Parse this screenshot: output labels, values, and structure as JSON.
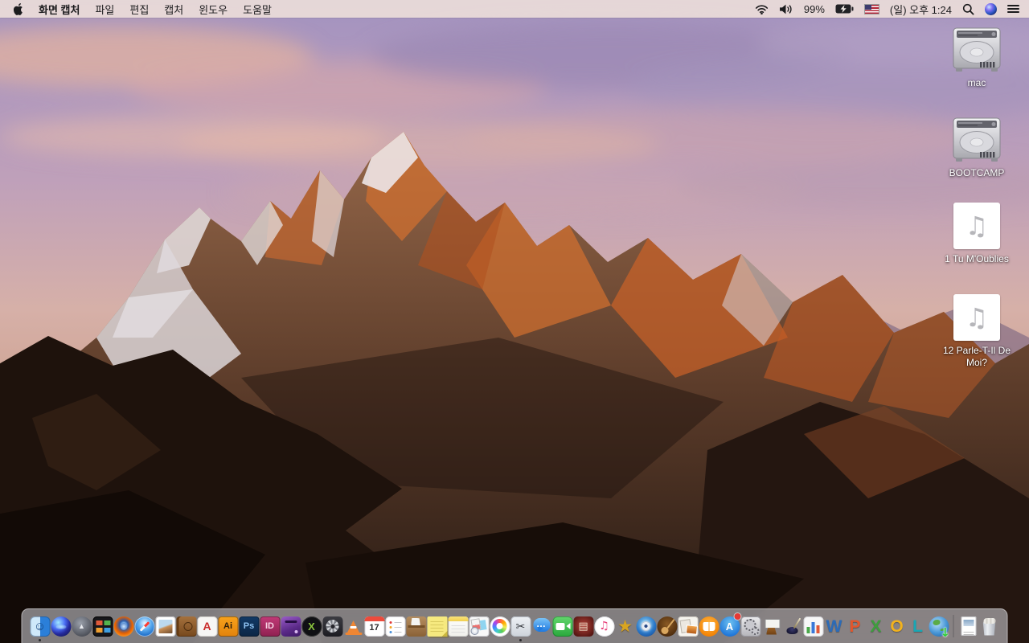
{
  "menu_bar": {
    "app_name": "화면 캡처",
    "menus": [
      "파일",
      "편집",
      "캡처",
      "윈도우",
      "도움말"
    ],
    "status": {
      "battery_percent": "99%",
      "clock": "(일) 오후 1:24"
    },
    "status_icons": [
      "wifi-icon",
      "volume-icon",
      "battery-charging-icon",
      "us-flag-keyboard-icon",
      "spotlight-search-icon",
      "siri-icon",
      "notification-center-icon"
    ]
  },
  "desktop": {
    "icons": [
      {
        "label": "mac",
        "kind": "hdd"
      },
      {
        "label": "BOOTCAMP",
        "kind": "hdd"
      },
      {
        "label": "1 Tu M'Oublies",
        "kind": "audio",
        "glyph": "♫"
      },
      {
        "label": "12 Parle-T-Il De Moi?",
        "kind": "audio",
        "glyph": "♫"
      }
    ]
  },
  "dock": {
    "items": [
      {
        "id": "finder",
        "label": "Finder",
        "kind": "finder",
        "glyph": "☺",
        "running": true
      },
      {
        "id": "siri",
        "label": "Siri",
        "kind": "siri",
        "shape": "circle"
      },
      {
        "id": "launchpad",
        "label": "Launchpad",
        "kind": "launchpad",
        "shape": "circle",
        "glyph": "▲"
      },
      {
        "id": "mission-control",
        "label": "Mission Control",
        "kind": "mission-control"
      },
      {
        "id": "firefox",
        "label": "Firefox",
        "kind": "firefox",
        "shape": "circle"
      },
      {
        "id": "safari",
        "label": "Safari",
        "kind": "safari",
        "shape": "circle"
      },
      {
        "id": "preview",
        "label": "Preview",
        "kind": "photo-bird"
      },
      {
        "id": "contacts-book",
        "label": "Leather Address Book",
        "kind": "leather-book"
      },
      {
        "id": "acrobat",
        "label": "Adobe Acrobat Reader",
        "kind": "acrobat",
        "glyph": "A",
        "fg": "#c92a2a"
      },
      {
        "id": "illustrator",
        "label": "Adobe Illustrator",
        "kind": "adobe",
        "glyph": "Ai",
        "bg": "linear-gradient(#f7a21b,#e2830d)",
        "fg": "#30200a"
      },
      {
        "id": "photoshop",
        "label": "Adobe Photoshop",
        "kind": "adobe",
        "glyph": "Ps",
        "bg": "linear-gradient(#123a66,#0b2544)",
        "fg": "#8fc3f2"
      },
      {
        "id": "indesign",
        "label": "Adobe InDesign",
        "kind": "adobe",
        "glyph": "ID",
        "bg": "linear-gradient(#c23a77,#8e2050)",
        "fg": "#f7d2e4"
      },
      {
        "id": "toast",
        "label": "Toast Titanium",
        "kind": "toast"
      },
      {
        "id": "x-media-app",
        "label": "XBMC Media App",
        "kind": "x-circle",
        "shape": "circle",
        "glyph": "X",
        "bg": "#101014",
        "fg": "#8cc63e"
      },
      {
        "id": "disk-fan-app",
        "label": "Disk Fan App",
        "kind": "fan"
      },
      {
        "id": "vlc",
        "label": "VLC",
        "kind": "vlc"
      },
      {
        "id": "calendar",
        "label": "Calendar",
        "kind": "calendar",
        "glyph": "17"
      },
      {
        "id": "reminders",
        "label": "Reminders",
        "kind": "reminders"
      },
      {
        "id": "package-box-app",
        "label": "Package Box App",
        "kind": "box"
      },
      {
        "id": "stickies",
        "label": "Stickies",
        "kind": "stickies"
      },
      {
        "id": "notes",
        "label": "Notes",
        "kind": "notes"
      },
      {
        "id": "photo-cards-app",
        "label": "Photo Cards App",
        "kind": "cards"
      },
      {
        "id": "photos",
        "label": "Photos",
        "kind": "photos",
        "shape": "circle"
      },
      {
        "id": "grab",
        "label": "화면 캡처",
        "kind": "grab",
        "glyph": "✂",
        "running": true
      },
      {
        "id": "messages",
        "label": "Messages",
        "kind": "messages",
        "glyph": "…"
      },
      {
        "id": "facetime",
        "label": "FaceTime",
        "kind": "facetime"
      },
      {
        "id": "photo-booth",
        "label": "Photo Booth",
        "kind": "photobooth",
        "glyph": "▤"
      },
      {
        "id": "itunes",
        "label": "iTunes",
        "kind": "itunes",
        "shape": "circle",
        "glyph": "♫",
        "fg": "#e8457d"
      },
      {
        "id": "star-app",
        "label": "Gold Star App",
        "kind": "star",
        "glyph": "★",
        "fg": "#d9a520"
      },
      {
        "id": "dvd-app",
        "label": "DVD Media App",
        "kind": "dvd",
        "shape": "circle"
      },
      {
        "id": "garageband",
        "label": "GarageBand",
        "kind": "garageband",
        "shape": "circle"
      },
      {
        "id": "photo-collage-app",
        "label": "Photo Collage App",
        "kind": "collage"
      },
      {
        "id": "ibooks",
        "label": "iBooks",
        "kind": "ibooks",
        "shape": "circle"
      },
      {
        "id": "app-store",
        "label": "App Store",
        "kind": "appstore",
        "shape": "circle",
        "glyph": "A",
        "badge": true
      },
      {
        "id": "system-preferences",
        "label": "System Preferences",
        "kind": "sysprefs"
      },
      {
        "id": "keynote",
        "label": "Keynote",
        "kind": "keynote"
      },
      {
        "id": "pages",
        "label": "Pages",
        "kind": "pages-old"
      },
      {
        "id": "numbers",
        "label": "Numbers",
        "kind": "numbers-old"
      },
      {
        "id": "word",
        "label": "Microsoft Word",
        "kind": "letter",
        "glyph": "W",
        "fg": "#2b6bb8"
      },
      {
        "id": "powerpoint",
        "label": "Microsoft PowerPoint",
        "kind": "letter",
        "glyph": "P",
        "fg": "#e2572d"
      },
      {
        "id": "excel",
        "label": "Microsoft Excel",
        "kind": "letter",
        "glyph": "X",
        "fg": "#3e9e3e"
      },
      {
        "id": "outlook",
        "label": "Microsoft Outlook",
        "kind": "letter",
        "glyph": "O",
        "fg": "#f2b21d"
      },
      {
        "id": "lync",
        "label": "Microsoft Lync",
        "kind": "letter",
        "glyph": "L",
        "fg": "#18a7b5"
      },
      {
        "id": "globe-download-app",
        "label": "Globe Download App",
        "kind": "globe",
        "shape": "circle",
        "glyph": "↓",
        "fg": "#2ecb3a"
      },
      {
        "id": "divider",
        "kind": "divider"
      },
      {
        "id": "document-file",
        "label": "Document",
        "kind": "docfile"
      },
      {
        "id": "trash",
        "label": "휴지통",
        "kind": "trash"
      }
    ]
  },
  "colors": {
    "menu_bar_bg": "#e9dad8",
    "dock_bg": "rgba(228,231,237,0.52)",
    "desktop_label": "#ffffff"
  }
}
